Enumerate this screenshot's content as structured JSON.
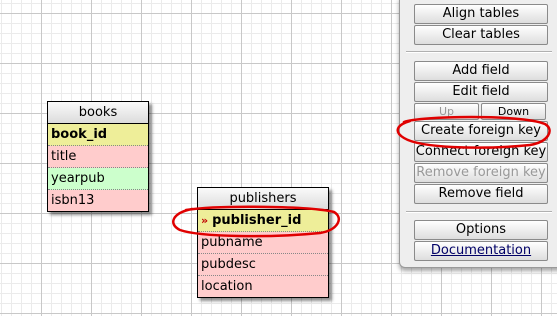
{
  "tables": {
    "books": {
      "name": "books",
      "fields": [
        {
          "name": "book_id",
          "style": "pk"
        },
        {
          "name": "title",
          "style": "plain"
        },
        {
          "name": "yearpub",
          "style": "alt"
        },
        {
          "name": "isbn13",
          "style": "plain"
        }
      ]
    },
    "publishers": {
      "name": "publishers",
      "pk_marker": "»",
      "fields": [
        {
          "name": "publisher_id",
          "style": "pk"
        },
        {
          "name": "pubname",
          "style": "plain"
        },
        {
          "name": "pubdesc",
          "style": "plain"
        },
        {
          "name": "location",
          "style": "plain"
        }
      ]
    }
  },
  "panel": {
    "align_tables": "Align tables",
    "clear_tables": "Clear tables",
    "add_field": "Add field",
    "edit_field": "Edit field",
    "up": "Up",
    "down": "Down",
    "create_foreign_key": "Create foreign key",
    "connect_foreign_key": "Connect foreign key",
    "remove_foreign_key": "Remove foreign key",
    "remove_field": "Remove field",
    "options": "Options",
    "documentation": "Documentation"
  },
  "colors": {
    "pk_row": "#eeee99",
    "plain_row": "#ffcccc",
    "alt_row": "#ccffcc",
    "annotation": "#e00000",
    "panel": "#eeeeee"
  }
}
